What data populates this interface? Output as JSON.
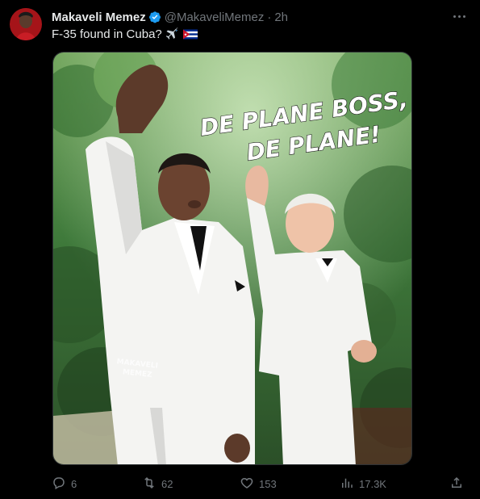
{
  "tweet": {
    "display_name": "Makaveli Memez",
    "handle": "@MakaveliMemez",
    "separator": "·",
    "time": "2h",
    "text": "F-35 found in Cuba?",
    "emojis": [
      "airplane-emoji",
      "cuba-flag-emoji"
    ]
  },
  "media": {
    "caption_line1": "DE PLANE BOSS,",
    "caption_line2": "DE PLANE!",
    "watermark_line1": "MAKAVELI",
    "watermark_line2": "MEMEZ"
  },
  "actions": {
    "reply_count": "6",
    "retweet_count": "62",
    "like_count": "153",
    "views_count": "17.3K"
  },
  "colors": {
    "background": "#000000",
    "text": "#e7e9ea",
    "muted": "#71767b",
    "verified": "#1d9bf0"
  }
}
